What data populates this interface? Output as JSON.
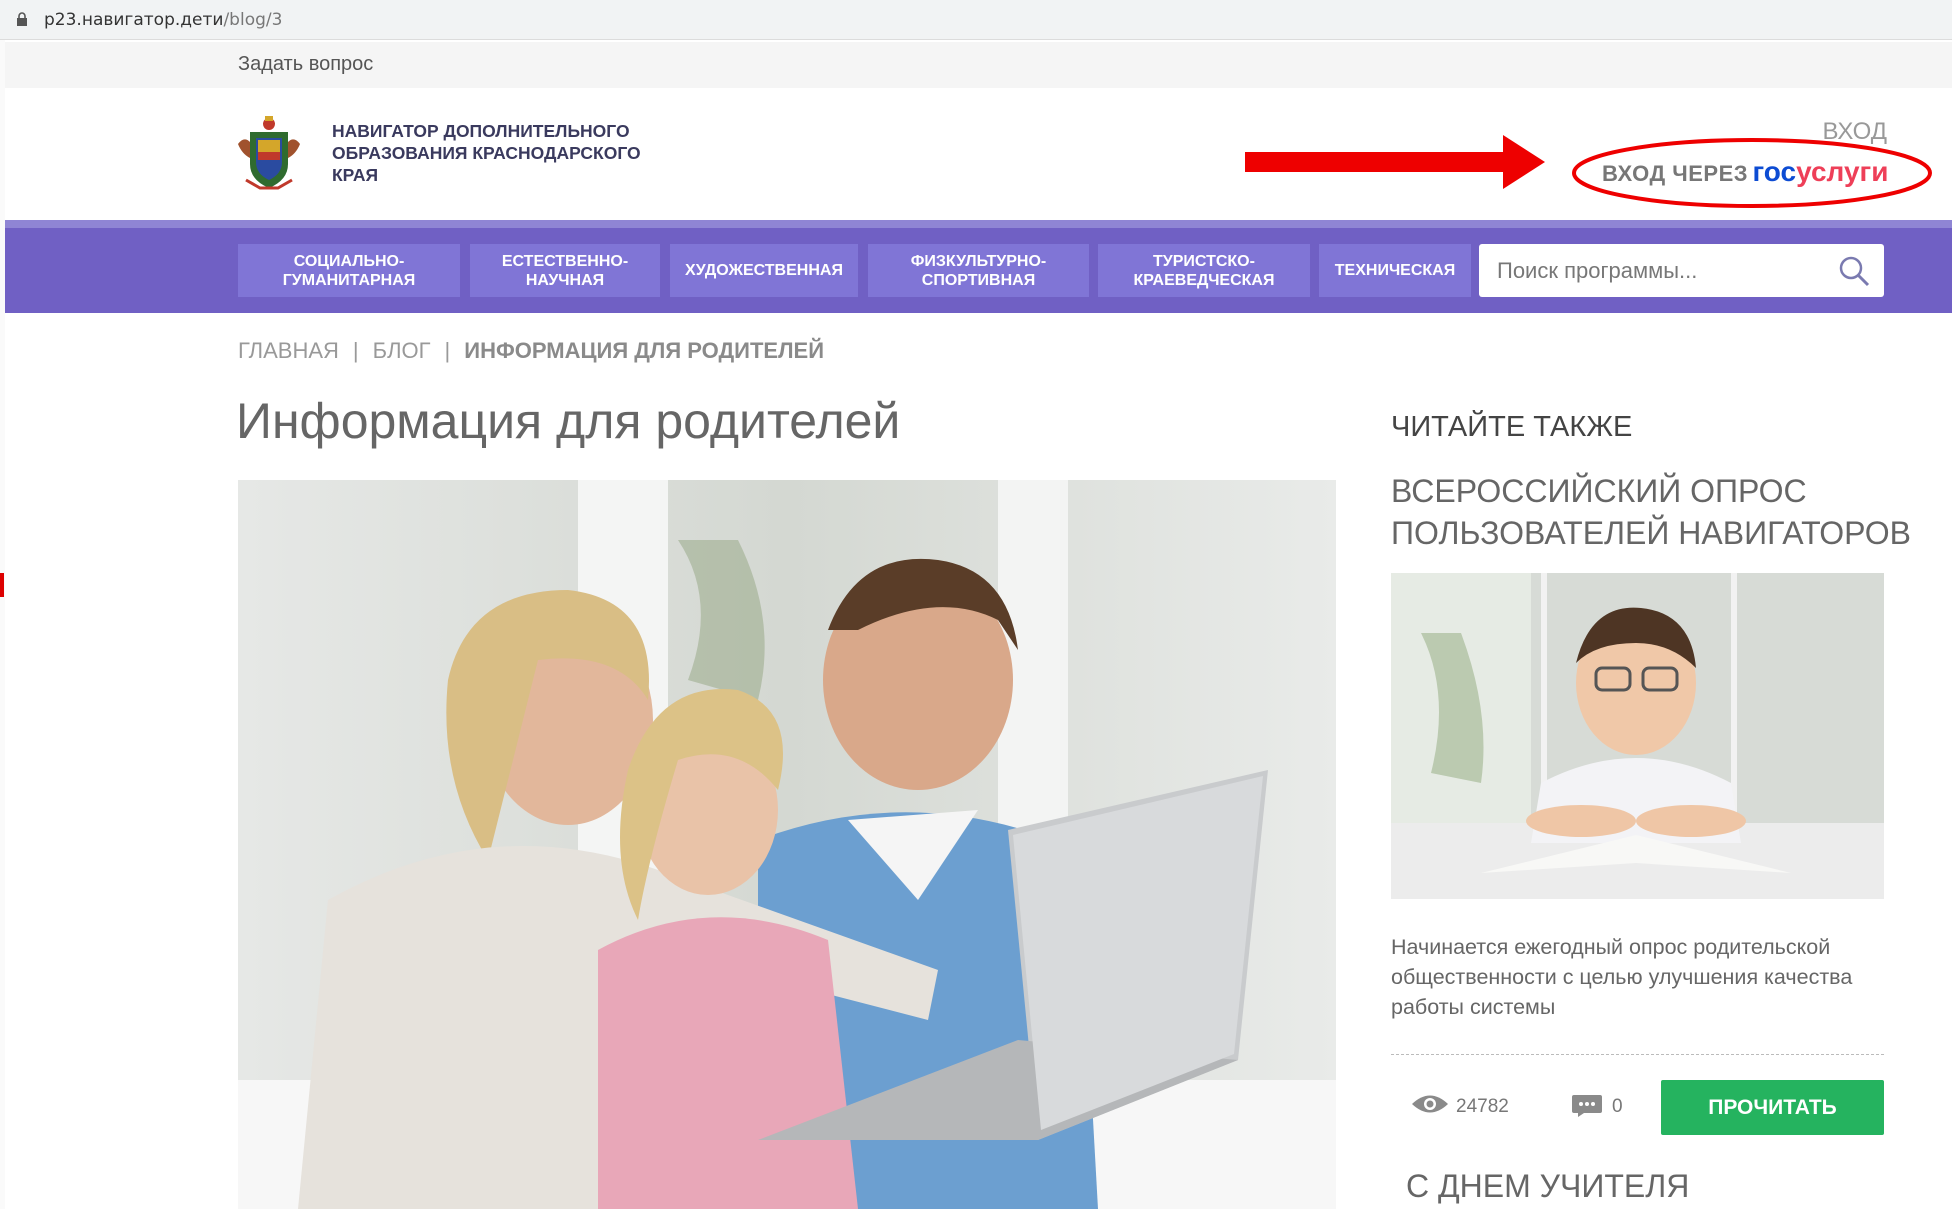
{
  "browser": {
    "url_host": "p23.навигатор.дети",
    "url_path": "/blog/3"
  },
  "topbar": {
    "ask_label": "Задать вопрос"
  },
  "header": {
    "brand": "НАВИГАТОР ДОПОЛНИТЕЛЬНОГО ОБРАЗОВАНИЯ КРАСНОДАРСКОГО КРАЯ",
    "login_label": "ВХОД",
    "gosuslugi_prefix": "ВХОД ЧЕРЕЗ",
    "gosuslugi_part1": "гос",
    "gosuslugi_part2": "услуги"
  },
  "nav": {
    "items": [
      {
        "label": "СОЦИАЛЬНО-ГУМАНИТАРНАЯ"
      },
      {
        "label": "ЕСТЕСТВЕННО-НАУЧНАЯ"
      },
      {
        "label": "ХУДОЖЕСТВЕННАЯ"
      },
      {
        "label": "ФИЗКУЛЬТУРНО-СПОРТИВНАЯ"
      },
      {
        "label": "ТУРИСТСКО-КРАЕВЕДЧЕСКАЯ"
      },
      {
        "label": "ТЕХНИЧЕСКАЯ"
      }
    ],
    "search_placeholder": "Поиск программы..."
  },
  "breadcrumb": {
    "home": "ГЛАВНАЯ",
    "blog": "БЛОГ",
    "current": "ИНФОРМАЦИЯ ДЛЯ РОДИТЕЛЕЙ"
  },
  "page": {
    "title": "Информация для родителей"
  },
  "sidebar": {
    "title": "ЧИТАЙТЕ ТАКЖЕ",
    "article1": {
      "title": "ВСЕРОССИЙСКИЙ ОПРОС ПОЛЬЗОВАТЕЛЕЙ НАВИГАТОРОВ",
      "text": "Начинается ежегодный опрос родительской общественности с целью улучшения качества работы системы",
      "views": "24782",
      "comments": "0",
      "read_label": "ПРОЧИТАТЬ"
    },
    "article2": {
      "title": "С ДНЕМ УЧИТЕЛЯ"
    }
  },
  "colors": {
    "nav_bg": "#7060c4",
    "nav_button": "#8075d6",
    "read_button": "#25b35f",
    "annotation_red": "#ee0000",
    "gos_blue": "#0d4cd3",
    "gos_red": "#ee3f58"
  },
  "icons": {
    "lock": "lock-icon",
    "search": "search-icon",
    "eye": "eye-icon",
    "comment": "comment-icon",
    "arrow": "annotation-arrow"
  }
}
